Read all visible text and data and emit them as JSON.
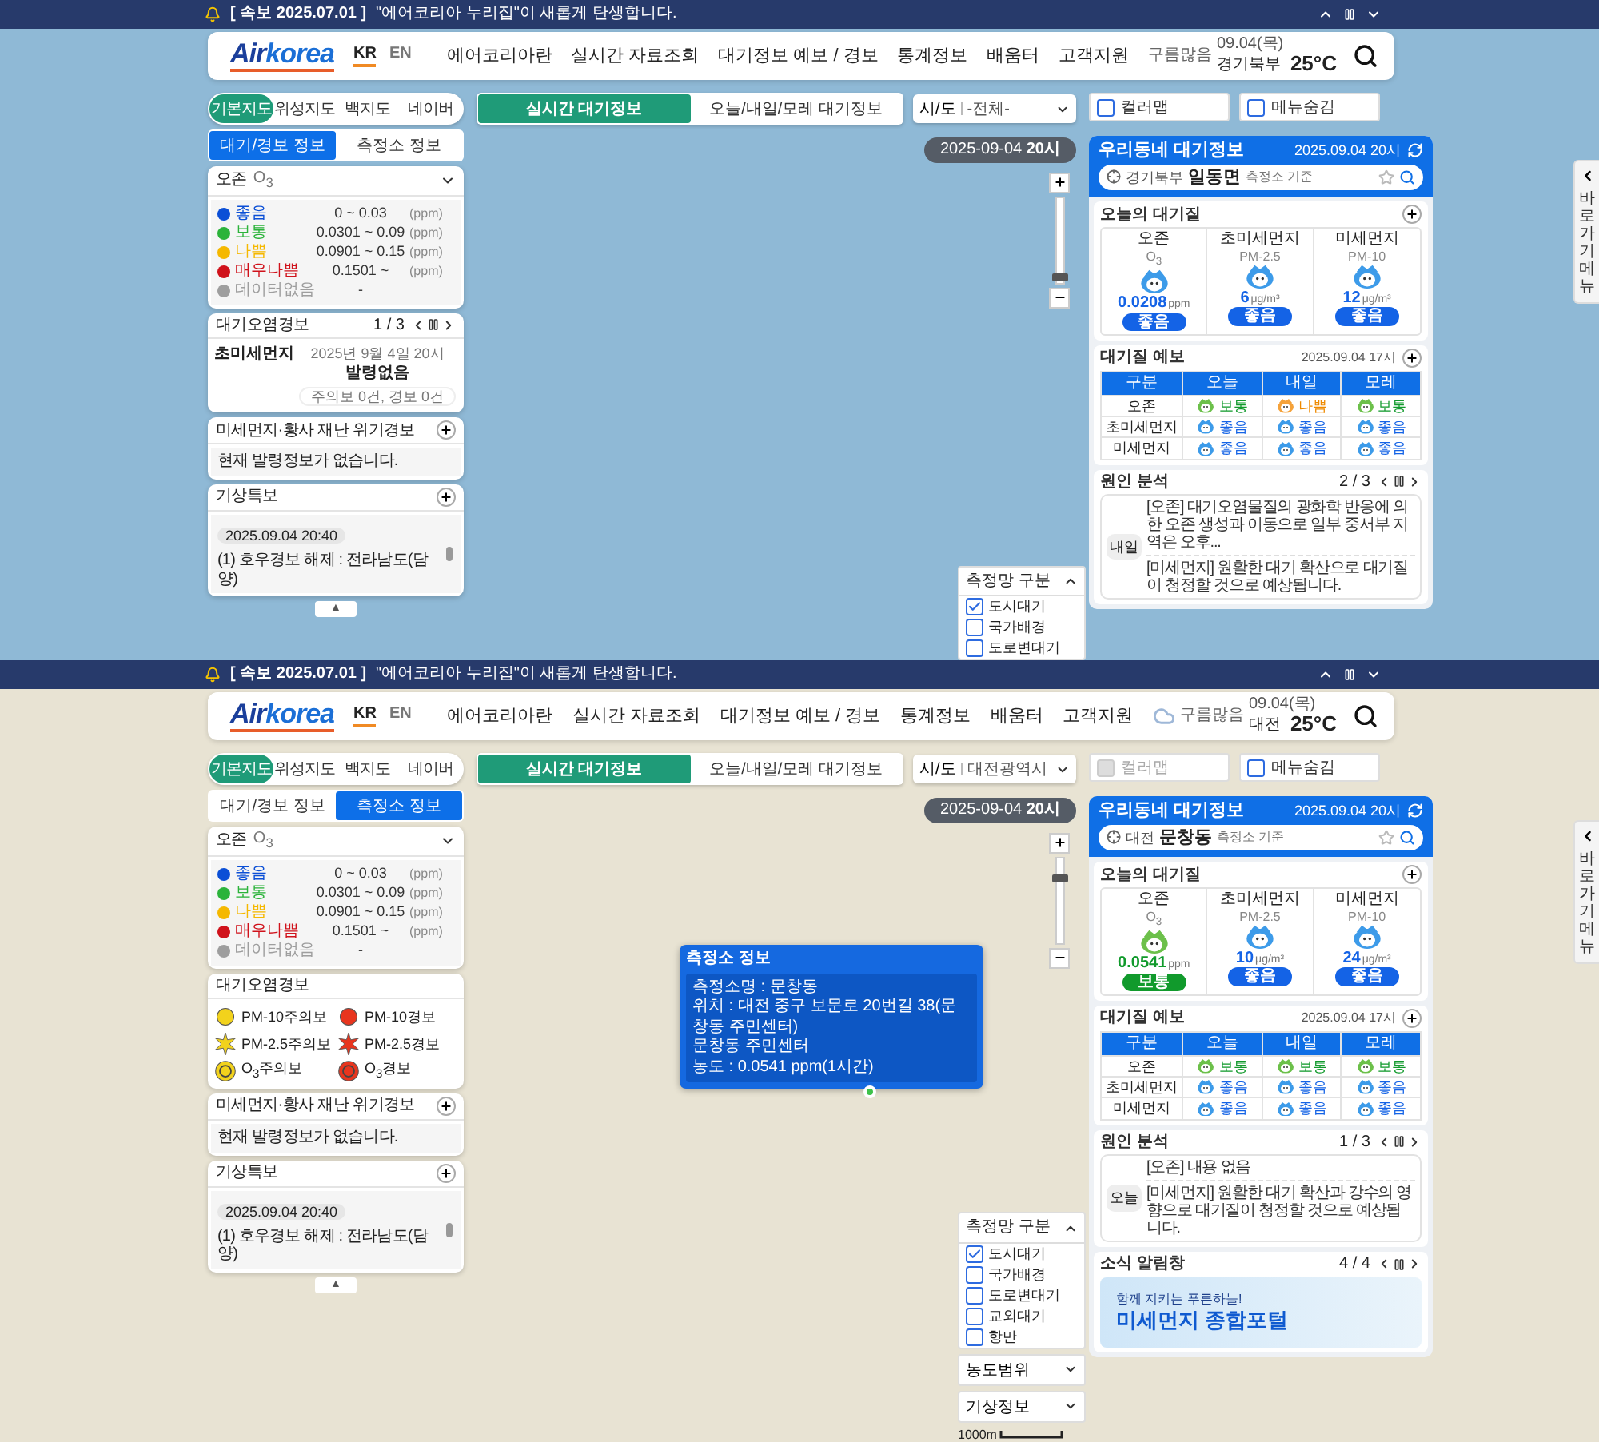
{
  "screens": [
    {
      "notice": {
        "label": "[ 속보 2025.07.01 ]",
        "text": "\"에어코리아 누리집\"이 새롭게 탄생합니다."
      },
      "logo_parts": [
        "Air",
        "korea"
      ],
      "langs": [
        {
          "label": "KR",
          "selected": true
        },
        {
          "label": "EN",
          "selected": false
        }
      ],
      "nav": [
        "에어코리아란",
        "실시간 자료조회",
        "대기정보 예보 / 경보",
        "통계정보",
        "배움터",
        "고객지원"
      ],
      "weather": {
        "date": "09.04(목)",
        "condition": "구름많음",
        "region": "경기북부",
        "temp": "25°C",
        "cloud_icon": false
      },
      "map": {
        "kind": "sea"
      },
      "map_types": [
        {
          "label": "기본지도",
          "selected": true
        },
        {
          "label": "위성지도",
          "selected": false
        },
        {
          "label": "백지도",
          "selected": false
        },
        {
          "label": "네이버",
          "selected": false
        }
      ],
      "info_tabs": [
        {
          "label": "대기/경보 정보",
          "selected": true
        },
        {
          "label": "측정소 정보",
          "selected": false
        }
      ],
      "legend": {
        "title": "오존",
        "formula": "O$_{3}$",
        "levels": [
          {
            "label": "좋음",
            "range": "0 ~ 0.03",
            "unit": "(ppm)",
            "color": "#0b4fd6"
          },
          {
            "label": "보통",
            "range": "0.0301 ~ 0.09",
            "unit": "(ppm)",
            "color": "#2bb33a"
          },
          {
            "label": "나쁨",
            "range": "0.0901 ~ 0.15",
            "unit": "(ppm)",
            "color": "#f5b800"
          },
          {
            "label": "매우나쁨",
            "range": "0.1501 ~",
            "unit": "(ppm)",
            "color": "#d0121b"
          },
          {
            "label": "데이터없음",
            "range": "-",
            "color": "#9e9e9e"
          }
        ]
      },
      "alert": {
        "kind": "status",
        "title": "대기오염경보",
        "pager": "1 / 3",
        "pollutant": "초미세먼지",
        "date": "2025년 9월 4일 20시",
        "status": "발령없음",
        "summary": "주의보 0건, 경보 0건"
      },
      "disaster": {
        "title": "미세먼지·황사 재난 위기경보",
        "text": "현재 발령정보가 없습니다."
      },
      "weather_alert": {
        "title": "기상특보",
        "date": "2025.09.04 20:40",
        "text": "(1) 호우경보 해제 : 전라남도(담양)"
      },
      "collapse": "▲",
      "mode_tabs": [
        {
          "label": "실시간 대기정보",
          "selected": true
        },
        {
          "label": "오늘/내일/모레 대기정보",
          "selected": false
        }
      ],
      "region_select": {
        "label": "시/도",
        "value": "-전체-"
      },
      "color_map": {
        "label": "컬러맵",
        "checked": false,
        "disabled": false
      },
      "menu_hide": {
        "label": "메뉴숨김",
        "checked": false
      },
      "time_badge": "2025-09-04 **20시**",
      "zoom": {
        "level": 0.05
      },
      "network_filter": {
        "title": "측정망 구분",
        "options": [
          {
            "label": "도시대기",
            "checked": true
          },
          {
            "label": "국가배경",
            "checked": false
          },
          {
            "label": "도로변대기",
            "checked": false
          }
        ]
      },
      "station": {
        "title": "우리동네 대기정보",
        "time": "2025.09.04 20시",
        "region": "경기북부",
        "name": "일동면",
        "suffix": "측정소 기준"
      },
      "today": {
        "title": "오늘의 대기질",
        "items": [
          {
            "name": "오존",
            "code": "O$_{3}$",
            "value": "0.0208",
            "unit": "ppm",
            "grade": "좋음",
            "kind": "good"
          },
          {
            "name": "초미세먼지",
            "code": "PM-2.5",
            "value": "6",
            "unit": "μg/m³",
            "grade": "좋음",
            "kind": "good"
          },
          {
            "name": "미세먼지",
            "code": "PM-10",
            "value": "12",
            "unit": "μg/m³",
            "grade": "좋음",
            "kind": "good"
          }
        ]
      },
      "forecast": {
        "title": "대기질 예보",
        "time": "2025.09.04 17시",
        "columns": [
          "구분",
          "오늘",
          "내일",
          "모레"
        ],
        "rows": [
          {
            "cells": [
              {
                "kind": "label",
                "text": "오존"
              },
              {
                "kind": "normal",
                "text": "보통"
              },
              {
                "kind": "bad",
                "text": "나쁨"
              },
              {
                "kind": "normal",
                "text": "보통"
              }
            ]
          },
          {
            "cells": [
              {
                "kind": "label",
                "text": "초미세먼지"
              },
              {
                "kind": "good",
                "text": "좋음"
              },
              {
                "kind": "good",
                "text": "좋음"
              },
              {
                "kind": "good",
                "text": "좋음"
              }
            ]
          },
          {
            "cells": [
              {
                "kind": "label",
                "text": "미세먼지"
              },
              {
                "kind": "good",
                "text": "좋음"
              },
              {
                "kind": "good",
                "text": "좋음"
              },
              {
                "kind": "good",
                "text": "좋음"
              }
            ]
          }
        ]
      },
      "cause": {
        "title": "원인 분석",
        "pager": "2 / 3",
        "day": "내일",
        "paragraphs": [
          "[오존] 대기오염물질의 광화학 반응에 의한 오존 생성과 이동으로 일부 중서부 지역은 오후...",
          "[미세먼지] 원활한 대기 확산으로 대기질이 청정할 것으로 예상됩니다."
        ]
      },
      "side_tab": "바로가기 메뉴"
    },
    {
      "notice": {
        "label": "[ 속보 2025.07.01 ]",
        "text": "\"에어코리아 누리집\"이 새롭게 탄생합니다."
      },
      "logo_parts": [
        "Air",
        "korea"
      ],
      "langs": [
        {
          "label": "KR",
          "selected": true
        },
        {
          "label": "EN",
          "selected": false
        }
      ],
      "nav": [
        "에어코리아란",
        "실시간 자료조회",
        "대기정보 예보 / 경보",
        "통계정보",
        "배움터",
        "고객지원"
      ],
      "weather": {
        "date": "09.04(목)",
        "condition": "구름많음",
        "region": "대전",
        "temp": "25°C",
        "cloud_icon": true
      },
      "map": {
        "kind": "city"
      },
      "map_types": [
        {
          "label": "기본지도",
          "selected": true
        },
        {
          "label": "위성지도",
          "selected": false
        },
        {
          "label": "백지도",
          "selected": false
        },
        {
          "label": "네이버",
          "selected": false
        }
      ],
      "info_tabs": [
        {
          "label": "대기/경보 정보",
          "selected": false
        },
        {
          "label": "측정소 정보",
          "selected": true
        }
      ],
      "legend": {
        "title": "오존",
        "formula": "O$_{3}$",
        "levels": [
          {
            "label": "좋음",
            "range": "0 ~ 0.03",
            "unit": "(ppm)",
            "color": "#0b4fd6"
          },
          {
            "label": "보통",
            "range": "0.0301 ~ 0.09",
            "unit": "(ppm)",
            "color": "#2bb33a"
          },
          {
            "label": "나쁨",
            "range": "0.0901 ~ 0.15",
            "unit": "(ppm)",
            "color": "#f5b800"
          },
          {
            "label": "매우나쁨",
            "range": "0.1501 ~",
            "unit": "(ppm)",
            "color": "#d0121b"
          },
          {
            "label": "데이터없음",
            "range": "-",
            "color": "#9e9e9e"
          }
        ]
      },
      "alert": {
        "kind": "legend",
        "title": "대기오염경보",
        "items": [
          {
            "label": "PM-10주의보",
            "kind": "pm10",
            "color": "#f2d21c"
          },
          {
            "label": "PM-10경보",
            "kind": "pm10",
            "color": "#e8351e"
          },
          {
            "label": "PM-2.5주의보",
            "kind": "pm25",
            "color": "#f2d21c"
          },
          {
            "label": "PM-2.5경보",
            "kind": "pm25",
            "color": "#e8351e"
          },
          {
            "label": "O$_{3}$주의보",
            "kind": "o3",
            "color": "#f2d21c"
          },
          {
            "label": "O$_{3}$경보",
            "kind": "o3",
            "color": "#e8351e"
          }
        ]
      },
      "disaster": {
        "title": "미세먼지·황사 재난 위기경보",
        "text": "현재 발령정보가 없습니다."
      },
      "weather_alert": {
        "title": "기상특보",
        "date": "2025.09.04 20:40",
        "text": "(1) 호우경보 해제 : 전라남도(담양)"
      },
      "collapse": "▲",
      "mode_tabs": [
        {
          "label": "실시간 대기정보",
          "selected": true
        },
        {
          "label": "오늘/내일/모레 대기정보",
          "selected": false
        }
      ],
      "region_select": {
        "label": "시/도",
        "value": "대전광역시"
      },
      "color_map": {
        "label": "컬러맵",
        "checked": false,
        "disabled": true
      },
      "menu_hide": {
        "label": "메뉴숨김",
        "checked": false
      },
      "time_badge": "2025-09-04 **20시**",
      "zoom": {
        "level": 0.8
      },
      "popup": {
        "title": "측정소 정보",
        "lines": [
          "측정소명 : 문창동",
          "위치 : 대전 중구 보문로 20번길 38(문창동 주민센터)",
          "문창동 주민센터",
          "농도 : 0.0541 ppm(1시간)"
        ]
      },
      "network_filter": {
        "title": "측정망 구분",
        "options": [
          {
            "label": "도시대기",
            "checked": true
          },
          {
            "label": "국가배경",
            "checked": false
          },
          {
            "label": "도로변대기",
            "checked": false
          },
          {
            "label": "교외대기",
            "checked": false
          },
          {
            "label": "항만",
            "checked": false
          }
        ]
      },
      "dropdowns": [
        "농도범위",
        "기상정보"
      ],
      "scale": "1000m",
      "station": {
        "title": "우리동네 대기정보",
        "time": "2025.09.04 20시",
        "region": "대전",
        "name": "문창동",
        "suffix": "측정소 기준"
      },
      "today": {
        "title": "오늘의 대기질",
        "items": [
          {
            "name": "오존",
            "code": "O$_{3}$",
            "value": "0.0541",
            "unit": "ppm",
            "grade": "보통",
            "kind": "normal"
          },
          {
            "name": "초미세먼지",
            "code": "PM-2.5",
            "value": "10",
            "unit": "μg/m³",
            "grade": "좋음",
            "kind": "good"
          },
          {
            "name": "미세먼지",
            "code": "PM-10",
            "value": "24",
            "unit": "μg/m³",
            "grade": "좋음",
            "kind": "good"
          }
        ]
      },
      "forecast": {
        "title": "대기질 예보",
        "time": "2025.09.04 17시",
        "columns": [
          "구분",
          "오늘",
          "내일",
          "모레"
        ],
        "rows": [
          {
            "cells": [
              {
                "kind": "label",
                "text": "오존"
              },
              {
                "kind": "normal",
                "text": "보통"
              },
              {
                "kind": "normal",
                "text": "보통"
              },
              {
                "kind": "normal",
                "text": "보통"
              }
            ]
          },
          {
            "cells": [
              {
                "kind": "label",
                "text": "초미세먼지"
              },
              {
                "kind": "good",
                "text": "좋음"
              },
              {
                "kind": "good",
                "text": "좋음"
              },
              {
                "kind": "good",
                "text": "좋음"
              }
            ]
          },
          {
            "cells": [
              {
                "kind": "label",
                "text": "미세먼지"
              },
              {
                "kind": "good",
                "text": "좋음"
              },
              {
                "kind": "good",
                "text": "좋음"
              },
              {
                "kind": "good",
                "text": "좋음"
              }
            ]
          }
        ]
      },
      "cause": {
        "title": "원인 분석",
        "pager": "1 / 3",
        "day": "오늘",
        "paragraphs": [
          "[오존] 내용 없음",
          "[미세먼지] 원활한 대기 확산과 강수의 영향으로 대기질이 청정할 것으로 예상됩니다."
        ]
      },
      "news": {
        "title": "소식 알림창",
        "pager": "4 / 4",
        "kicker": "함께 지키는 푸른하늘!",
        "headline": "미세먼지 종합포털"
      },
      "side_tab": "바로가기 메뉴"
    }
  ]
}
